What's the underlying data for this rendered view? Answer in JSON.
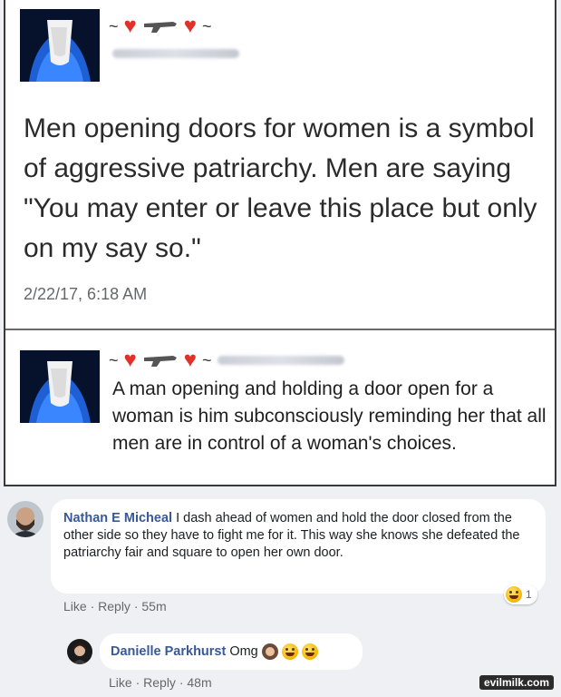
{
  "post1": {
    "name_prefix": "~",
    "name_suffix": "~",
    "text": "Men opening doors for women is a symbol of aggressive patriarchy. Men are saying \"You may enter or leave this place but only on my say so.\"",
    "date": "2/22/17, 6:18 AM"
  },
  "post2": {
    "name_prefix": "~",
    "name_mid": "~",
    "text": "A man opening and holding a door open for a woman is him subconsciously reminding her that all men are in control of a woman's choices."
  },
  "comments": [
    {
      "author": "Nathan E Micheal",
      "text": "I dash ahead of women and hold the door closed from the other side so they have to fight me for it. This way she knows she defeated the patriarchy fair and square to open her own door.",
      "like": "Like",
      "reply": "Reply",
      "time": "55m",
      "reaction_count": "1"
    },
    {
      "author": "Danielle Parkhurst",
      "text": "Omg",
      "like": "Like",
      "reply": "Reply",
      "time": "48m"
    }
  ],
  "watermark": "evilmilk.com",
  "colors": {
    "name_blue": "#385898",
    "heart": "#e0312b",
    "meta_gray": "#65676b"
  }
}
